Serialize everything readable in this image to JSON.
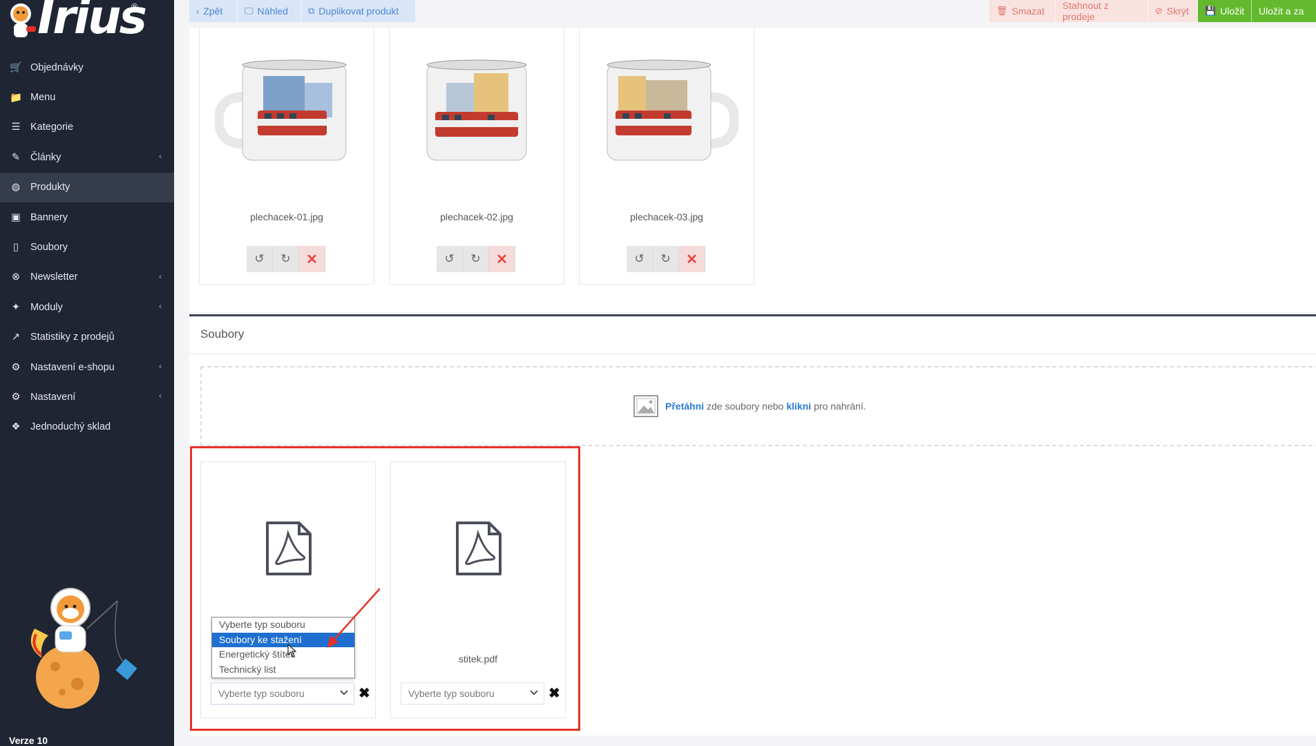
{
  "app": {
    "logo_text": "Irius",
    "logo_reg": "®",
    "version": "Verze 10"
  },
  "sidebar": {
    "items": [
      {
        "label": "Objednávky",
        "icon": "cart-icon",
        "caret": false,
        "active": false
      },
      {
        "label": "Menu",
        "icon": "folder-icon",
        "caret": false,
        "active": false
      },
      {
        "label": "Kategorie",
        "icon": "list-icon",
        "caret": false,
        "active": false
      },
      {
        "label": "Články",
        "icon": "pen-icon",
        "caret": true,
        "active": false
      },
      {
        "label": "Produkty",
        "icon": "basketball-icon",
        "caret": false,
        "active": true
      },
      {
        "label": "Bannery",
        "icon": "image-icon",
        "caret": false,
        "active": false
      },
      {
        "label": "Soubory",
        "icon": "file-icon",
        "caret": false,
        "active": false
      },
      {
        "label": "Newsletter",
        "icon": "envelope-icon",
        "caret": true,
        "active": false
      },
      {
        "label": "Moduly",
        "icon": "puzzle-icon",
        "caret": true,
        "active": false
      },
      {
        "label": "Statistiky z prodejů",
        "icon": "chart-line-icon",
        "caret": false,
        "active": false
      },
      {
        "label": "Nastavení e-shopu",
        "icon": "gears-icon",
        "caret": true,
        "active": false
      },
      {
        "label": "Nastavení",
        "icon": "gears-icon",
        "caret": true,
        "active": false
      },
      {
        "label": "Jednoduchý sklad",
        "icon": "dropbox-icon",
        "caret": false,
        "active": false
      }
    ]
  },
  "toolbar": {
    "back": "Zpět",
    "preview": "Náhled",
    "duplicate": "Duplikovat produkt",
    "delete": "Smazat",
    "withdraw": "Stahnout z prodeje",
    "hide": "Skrýt",
    "save": "Uložit",
    "save_close": "Uložit a za"
  },
  "images": [
    {
      "filename": "plechacek-01.jpg"
    },
    {
      "filename": "plechacek-02.jpg"
    },
    {
      "filename": "plechacek-03.jpg"
    }
  ],
  "files_section": {
    "title": "Soubory",
    "drop_drag": "Přetáhni",
    "drop_mid": "zde soubory nebo",
    "drop_click": "klikni",
    "drop_end": "pro nahrání."
  },
  "files": [
    {
      "filename": "",
      "select_value": "Vyberte typ souboru"
    },
    {
      "filename": "stitek.pdf",
      "select_value": "Vyberte typ souboru"
    }
  ],
  "dropdown": {
    "options": [
      "Vyberte typ souboru",
      "Soubory ke stažení",
      "Energetický štítek",
      "Technický list"
    ],
    "selected_index": 1
  },
  "colors": {
    "sidebar_bg": "#1f2533",
    "accent_blue": "#2b7ad3",
    "annotation_red": "#e53228",
    "save_green": "#63b92e"
  }
}
